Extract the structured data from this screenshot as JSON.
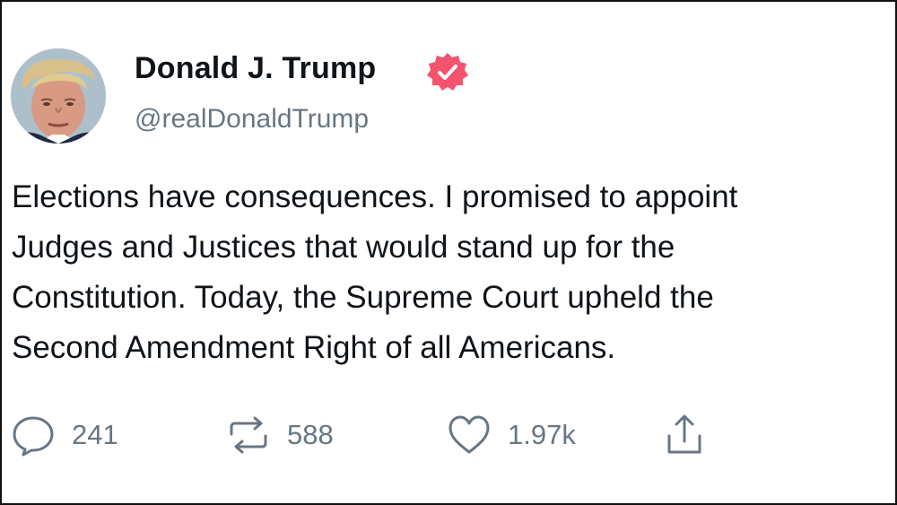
{
  "author": {
    "display_name": "Donald J. Trump",
    "handle": "@realDonaldTrump",
    "avatar_icon": "profile-photo",
    "verified_icon": "verified-badge-icon",
    "verified_color": "#f4536e"
  },
  "tweet": {
    "lines": [
      "Elections have consequences. I promised to appoint",
      "Judges and Justices that would stand up for the",
      "Constitution. Today, the Supreme Court upheld the",
      "Second Amendment Right of all Americans."
    ]
  },
  "actions": {
    "reply": {
      "icon": "reply-icon",
      "count": "241"
    },
    "retweet": {
      "icon": "retweet-icon",
      "count": "588"
    },
    "like": {
      "icon": "heart-icon",
      "count": "1.97k"
    },
    "share": {
      "icon": "share-icon"
    }
  },
  "colors": {
    "text": "#0f1419",
    "secondary": "#687684",
    "background": "#ffffff"
  }
}
